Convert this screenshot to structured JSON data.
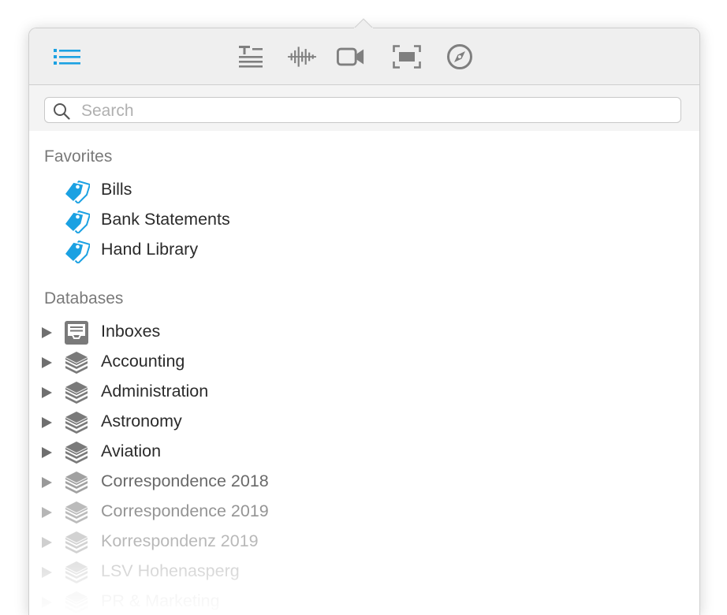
{
  "toolbar": {
    "buttons": [
      {
        "icon": "list-icon",
        "active": true
      },
      {
        "icon": "text-format-icon"
      },
      {
        "icon": "audio-waveform-icon"
      },
      {
        "icon": "video-camera-icon"
      },
      {
        "icon": "screen-capture-icon"
      },
      {
        "icon": "compass-icon"
      }
    ],
    "accent": "#1ba1e2"
  },
  "search": {
    "placeholder": "Search",
    "value": ""
  },
  "favorites": {
    "header": "Favorites",
    "items": [
      {
        "label": "Bills",
        "icon": "tag-icon"
      },
      {
        "label": "Bank Statements",
        "icon": "tag-icon"
      },
      {
        "label": "Hand Library",
        "icon": "tag-icon"
      }
    ]
  },
  "databases": {
    "header": "Databases",
    "items": [
      {
        "label": "Inboxes",
        "icon": "inbox-icon"
      },
      {
        "label": "Accounting",
        "icon": "database-icon"
      },
      {
        "label": "Administration",
        "icon": "database-icon"
      },
      {
        "label": "Astronomy",
        "icon": "database-icon"
      },
      {
        "label": "Aviation",
        "icon": "database-icon"
      },
      {
        "label": "Correspondence 2018",
        "icon": "database-icon"
      },
      {
        "label": "Correspondence 2019",
        "icon": "database-icon"
      },
      {
        "label": "Korrespondenz 2019",
        "icon": "database-icon"
      },
      {
        "label": "LSV Hohenasperg",
        "icon": "database-icon"
      },
      {
        "label": "PR & Marketing",
        "icon": "database-icon"
      }
    ]
  }
}
